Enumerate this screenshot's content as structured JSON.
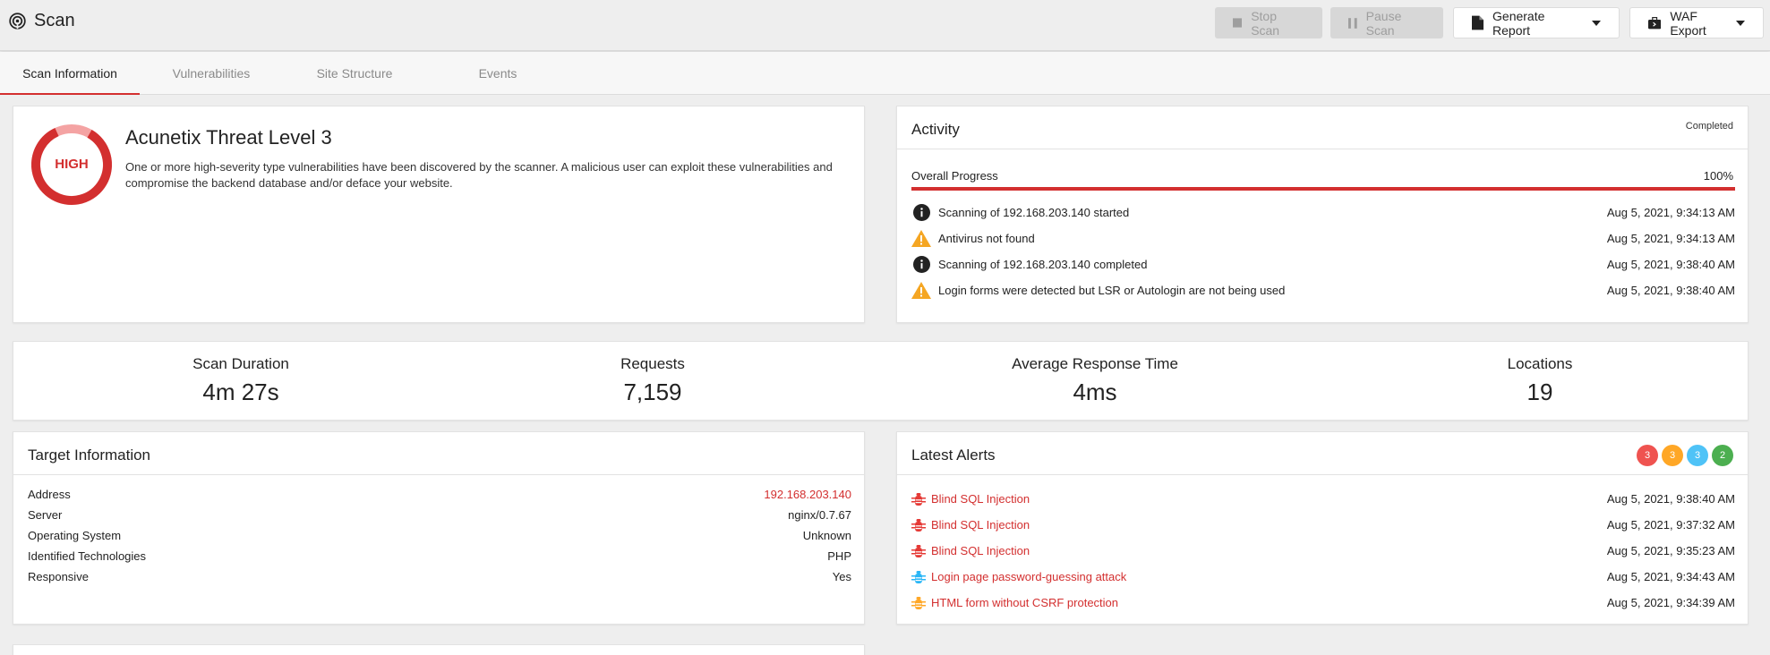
{
  "header": {
    "title": "Scan",
    "buttons": {
      "stop": "Stop Scan",
      "pause": "Pause Scan",
      "report": "Generate Report",
      "waf": "WAF Export"
    }
  },
  "tabs": [
    {
      "label": "Scan Information",
      "active": true
    },
    {
      "label": "Vulnerabilities",
      "active": false
    },
    {
      "label": "Site Structure",
      "active": false
    },
    {
      "label": "Events",
      "active": false
    }
  ],
  "threat": {
    "level_label": "HIGH",
    "title": "Acunetix Threat Level 3",
    "description": "One or more high-severity type vulnerabilities have been discovered by the scanner. A malicious user can exploit these vulnerabilities and compromise the backend database and/or deface your website.",
    "color": "#d32f2f"
  },
  "activity": {
    "title": "Activity",
    "status": "Completed",
    "progress_label": "Overall Progress",
    "progress_text": "100%",
    "progress_value": 100,
    "events": [
      {
        "icon": "info-icon",
        "text": "Scanning of 192.168.203.140 started",
        "time": "Aug 5, 2021, 9:34:13 AM"
      },
      {
        "icon": "warning-icon",
        "text": "Antivirus not found",
        "time": "Aug 5, 2021, 9:34:13 AM"
      },
      {
        "icon": "info-icon",
        "text": "Scanning of 192.168.203.140 completed",
        "time": "Aug 5, 2021, 9:38:40 AM"
      },
      {
        "icon": "warning-icon",
        "text": "Login forms were detected but LSR or Autologin are not being used",
        "time": "Aug 5, 2021, 9:38:40 AM"
      }
    ]
  },
  "stats": [
    {
      "label": "Scan Duration",
      "value": "4m 27s"
    },
    {
      "label": "Requests",
      "value": "7,159"
    },
    {
      "label": "Average Response Time",
      "value": "4ms"
    },
    {
      "label": "Locations",
      "value": "19"
    }
  ],
  "target": {
    "title": "Target Information",
    "rows": [
      {
        "label": "Address",
        "value": "192.168.203.140"
      },
      {
        "label": "Server",
        "value": "nginx/0.7.67"
      },
      {
        "label": "Operating System",
        "value": "Unknown"
      },
      {
        "label": "Identified Technologies",
        "value": "PHP"
      },
      {
        "label": "Responsive",
        "value": "Yes"
      }
    ]
  },
  "alerts": {
    "title": "Latest Alerts",
    "badges": [
      {
        "count": "3",
        "color": "#ef5350"
      },
      {
        "count": "3",
        "color": "#ffa726"
      },
      {
        "count": "3",
        "color": "#4fc3f7"
      },
      {
        "count": "2",
        "color": "#4caf50"
      }
    ],
    "items": [
      {
        "text": "Blind SQL Injection",
        "time": "Aug 5, 2021, 9:38:40 AM",
        "severity_color": "#e53935"
      },
      {
        "text": "Blind SQL Injection",
        "time": "Aug 5, 2021, 9:37:32 AM",
        "severity_color": "#e53935"
      },
      {
        "text": "Blind SQL Injection",
        "time": "Aug 5, 2021, 9:35:23 AM",
        "severity_color": "#e53935"
      },
      {
        "text": "Login page password-guessing attack",
        "time": "Aug 5, 2021, 9:34:43 AM",
        "severity_color": "#29b6f6"
      },
      {
        "text": "HTML form without CSRF protection",
        "time": "Aug 5, 2021, 9:34:39 AM",
        "severity_color": "#ffa726"
      }
    ]
  }
}
